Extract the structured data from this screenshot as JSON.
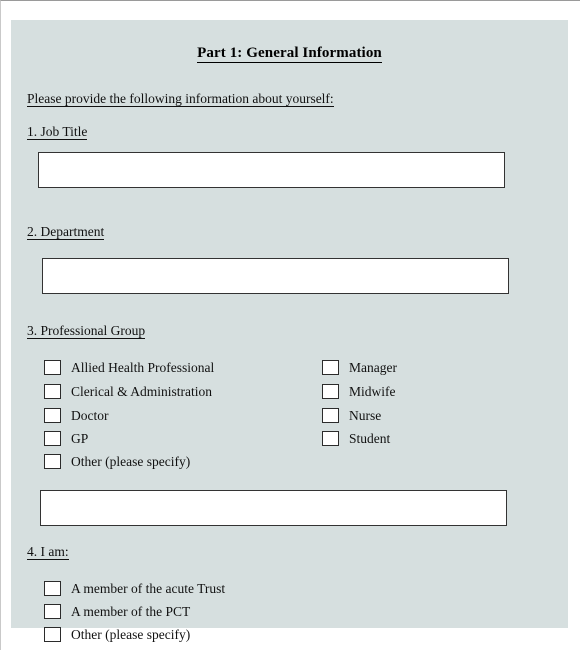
{
  "document": {
    "title": "Part 1: General Information",
    "intro": "Please provide the following information about yourself:",
    "background_color": "#d6dfdf",
    "text_color": "#111111",
    "field_background": "#ffffff",
    "field_border_color": "#333333"
  },
  "questions": {
    "q1": {
      "label": "1. Job Title",
      "input_value": "",
      "input_placeholder": ""
    },
    "q2": {
      "label": "2. Department",
      "input_value": "",
      "input_placeholder": ""
    },
    "q3": {
      "label": "3. Professional Group",
      "options_left": [
        "Allied Health Professional",
        "Clerical & Administration",
        "Doctor",
        "GP",
        "Other (please specify)"
      ],
      "options_right": [
        "Manager",
        "Midwife",
        "Nurse",
        "Student"
      ],
      "specify_value": "",
      "specify_placeholder": ""
    },
    "q4": {
      "label": "4. I am:",
      "options": [
        "A member of the acute Trust",
        "A member of the PCT",
        "Other (please specify)"
      ]
    }
  }
}
